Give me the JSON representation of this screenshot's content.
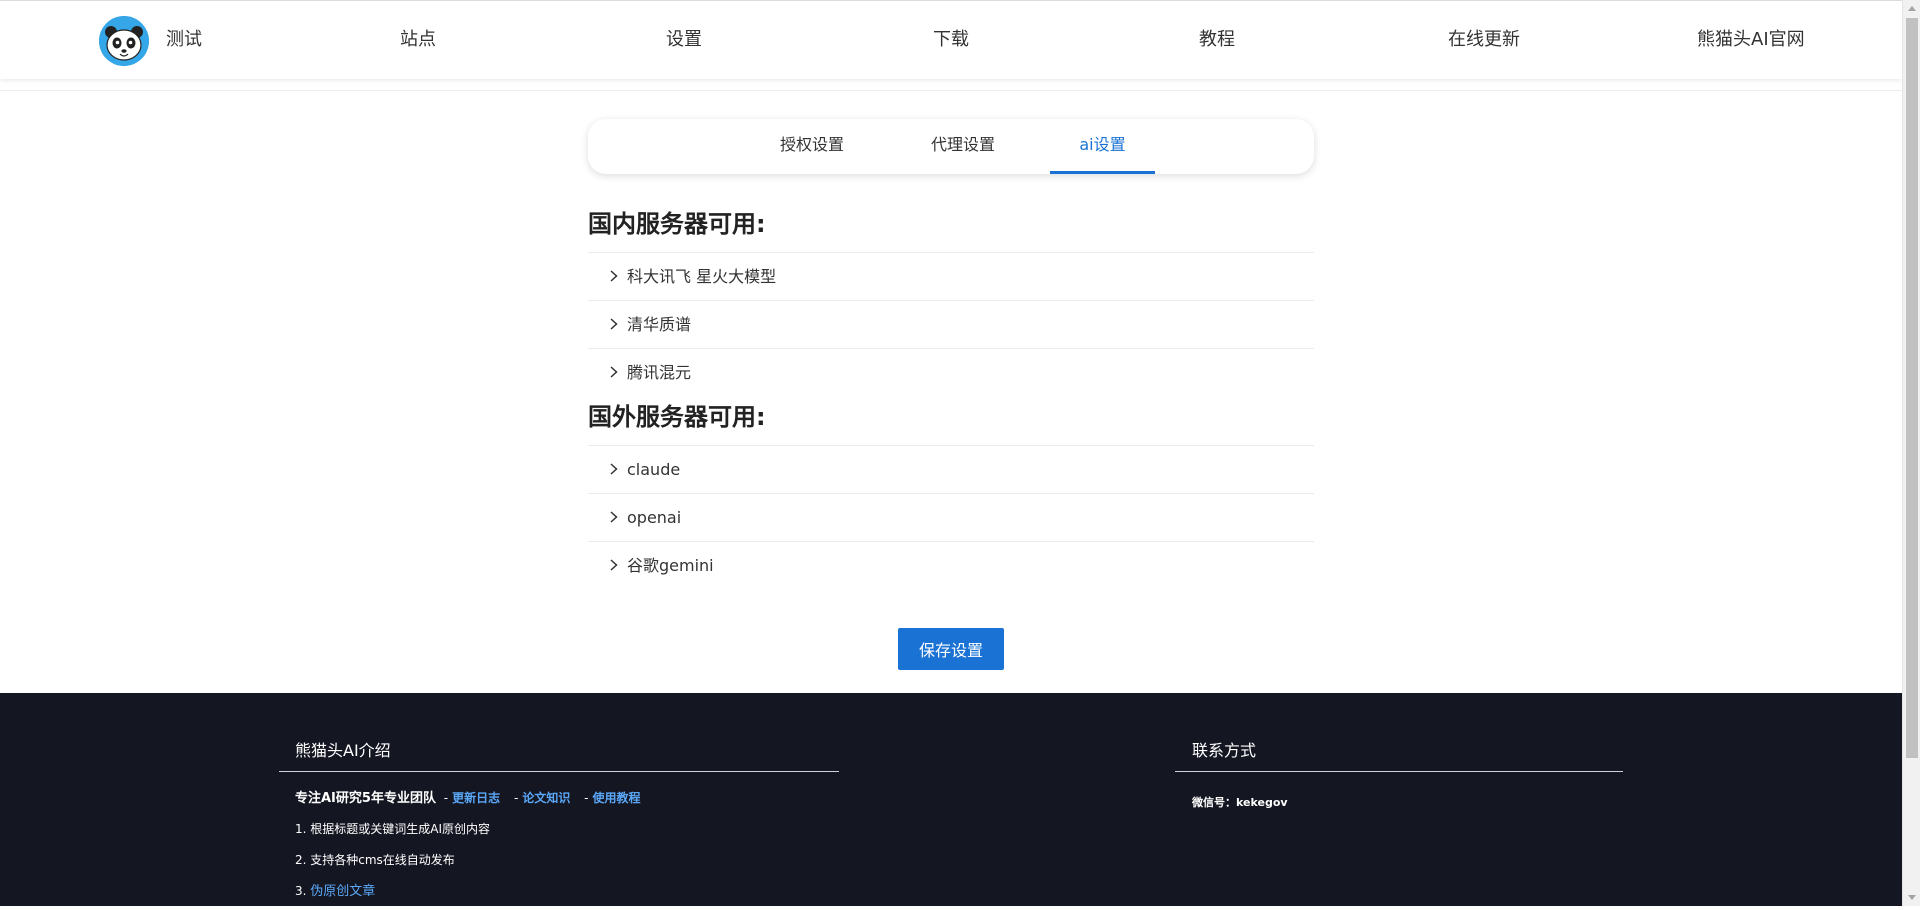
{
  "nav": {
    "brand_label": "测试",
    "items": [
      "站点",
      "设置",
      "下载",
      "教程",
      "在线更新",
      "熊猫头AI官网"
    ]
  },
  "tabs": [
    {
      "label": "授权设置",
      "active": false
    },
    {
      "label": "代理设置",
      "active": false
    },
    {
      "label": "ai设置",
      "active": true
    }
  ],
  "domestic": {
    "title": "国内服务器可用:",
    "items": [
      "科大讯飞 星火大模型",
      "清华质谱",
      "腾讯混元"
    ]
  },
  "foreign": {
    "title": "国外服务器可用:",
    "items": [
      "claude",
      "openai",
      "谷歌gemini"
    ]
  },
  "save_label": "保存设置",
  "footer": {
    "intro_title": "熊猫头AI介绍",
    "team_text": "专注AI研究5年专业团队",
    "link_changelog": "更新日志",
    "link_papers": "论文知识",
    "link_tutorial": "使用教程",
    "point1": "1. 根据标题或关键词生成AI原创内容",
    "point2": "2. 支持各种cms在线自动发布",
    "point3_prefix": "3.",
    "point3_link": "伪原创文章",
    "contact_title": "联系方式",
    "wechat": "微信号：kekegov"
  },
  "colors": {
    "accent": "#1a73d4",
    "footer_bg": "#141622",
    "footer_link": "#5ba7f7",
    "logo_bg": "#35a6e8"
  }
}
